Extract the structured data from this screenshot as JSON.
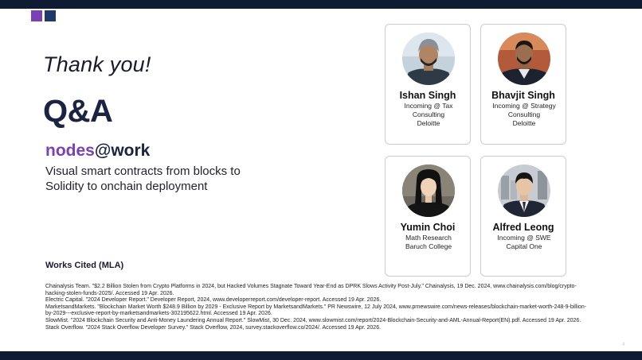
{
  "slide": {
    "thanks": "Thank you!",
    "qa": "Q&A",
    "brand_part1": "nodes",
    "brand_part2": "@work",
    "tagline": "Visual smart contracts from blocks to Solidity to onchain deployment",
    "page_number": "4"
  },
  "team": [
    {
      "name": "Ishan Singh",
      "lines": [
        "Incoming @ Tax",
        "Consulting",
        "Deloitte"
      ]
    },
    {
      "name": "Bhavjit Singh",
      "lines": [
        "Incoming @ Strategy",
        "Consulting",
        "Deloitte"
      ]
    },
    {
      "name": "Yumin Choi",
      "lines": [
        "Math Research",
        "Baruch College"
      ]
    },
    {
      "name": "Alfred Leong",
      "lines": [
        "Incoming @ SWE",
        "Capital One"
      ]
    }
  ],
  "works_cited": {
    "title": "Works Cited (MLA)",
    "entries": [
      "Chainalysis Team. \"$2.2 Billion Stolen from Crypto Platforms in 2024, but Hacked Volumes Stagnate Toward Year-End as DPRK Slows Activity Post-July.\" Chainalysis, 19 Dec. 2024, www.chainalysis.com/blog/crypto-hacking-stolen-funds-2025/. Accessed 19 Apr. 2026.",
      "Electric Capital. \"2024 Developer Report.\" Developer Report, 2024, www.developerreport.com/developer-report. Accessed 19 Apr. 2026.",
      "MarketsandMarkets. \"Blockchain Market Worth $248.9 Billion by 2029 - Exclusive Report by MarketsandMarkets.\" PR Newswire, 12 July 2024, www.prnewswire.com/news-releases/blockchain-market-worth-248-9-billion-by-2029---exclusive-report-by-marketsandmarkets-302195622.html. Accessed 19 Apr. 2026.",
      "SlowMist. \"2024 Blockchain Security and Anti-Money Laundering Annual Report.\" SlowMist, 30 Dec. 2024, www.slowmist.com/report/2024-Blockchain-Security-and-AML-Annual-Report(EN).pdf. Accessed 19 Apr. 2026.",
      "Stack Overflow. \"2024 Stack Overflow Developer Survey.\" Stack Overflow, 2024, survey.stackoverflow.co/2024/. Accessed 19 Apr. 2026."
    ]
  },
  "colors": {
    "brand_purple": "#7b3fb8",
    "brand_navy": "#1a2442",
    "bar": "#0f1a33"
  }
}
